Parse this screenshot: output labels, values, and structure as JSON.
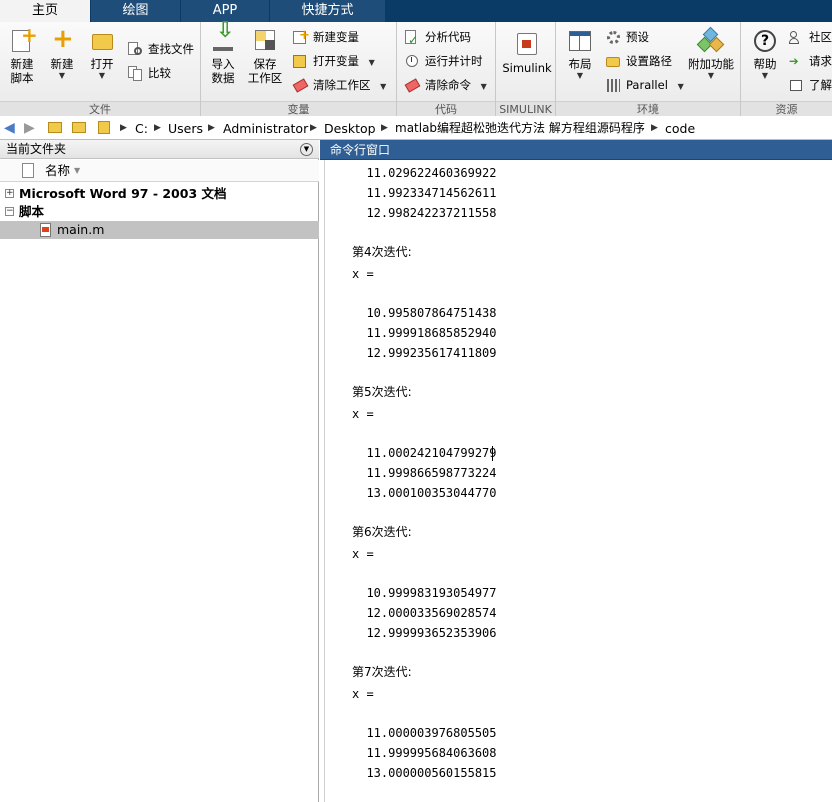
{
  "tabs": [
    {
      "label": "主页",
      "active": true
    },
    {
      "label": "绘图",
      "active": false
    },
    {
      "label": "APP",
      "active": false
    },
    {
      "label": "快捷方式",
      "active": false
    }
  ],
  "ribbon": {
    "file": {
      "group_label": "文件",
      "new_script": "新建\n脚本",
      "new": "新建",
      "open": "打开",
      "find_files": "查找文件",
      "compare": "比较"
    },
    "variable": {
      "group_label": "变量",
      "import_data": "导入\n数据",
      "save_workspace": "保存\n工作区",
      "new_variable": "新建变量",
      "open_variable": "打开变量",
      "clear_workspace": "清除工作区"
    },
    "code": {
      "group_label": "代码",
      "analyze_code": "分析代码",
      "run_and_time": "运行并计时",
      "clear_commands": "清除命令"
    },
    "simulink": {
      "group_label": "SIMULINK",
      "simulink": "Simulink"
    },
    "environment": {
      "group_label": "环境",
      "layout": "布局",
      "preferences": "预设",
      "set_path": "设置路径",
      "parallel": "Parallel",
      "add_ons": "附加功能"
    },
    "resources": {
      "group_label": "资源",
      "help": "帮助",
      "community": "社区",
      "request_support": "请求",
      "learn": "了解"
    }
  },
  "address": {
    "crumbs": [
      "C:",
      "Users",
      "Administrator",
      "Desktop",
      "matlab编程超松弛迭代方法 解方程组源码程序",
      "code"
    ]
  },
  "current_folder": {
    "title": "当前文件夹",
    "column_name": "名称",
    "groups": [
      {
        "label": "Microsoft Word 97 - 2003 文档",
        "expanded": false
      },
      {
        "label": "脚本",
        "expanded": true
      }
    ],
    "files": [
      {
        "name": "main.m",
        "selected": true
      }
    ]
  },
  "command_window": {
    "title": "命令行窗口",
    "lines": [
      {
        "text": "  11.029622460369922",
        "type": "value"
      },
      {
        "text": "  11.992334714562611",
        "type": "value"
      },
      {
        "text": "  12.998242237211558",
        "type": "value"
      },
      {
        "text": "第4次迭代:",
        "type": "head"
      },
      {
        "text": "x =",
        "type": "value"
      },
      {
        "text": "  10.995807864751438",
        "type": "value"
      },
      {
        "text": "  11.999918685852940",
        "type": "value"
      },
      {
        "text": "  12.999235617411809",
        "type": "value"
      },
      {
        "text": "第5次迭代:",
        "type": "head"
      },
      {
        "text": "x =",
        "type": "value"
      },
      {
        "text": "  11.000242104799279",
        "type": "value"
      },
      {
        "text": "  11.999866598773224",
        "type": "value"
      },
      {
        "text": "  13.000100353044770",
        "type": "value"
      },
      {
        "text": "第6次迭代:",
        "type": "head"
      },
      {
        "text": "x =",
        "type": "value"
      },
      {
        "text": "  10.999983193054977",
        "type": "value"
      },
      {
        "text": "  12.000033569028574",
        "type": "value"
      },
      {
        "text": "  12.999993652353906",
        "type": "value"
      },
      {
        "text": "第7次迭代:",
        "type": "head"
      },
      {
        "text": "x =",
        "type": "value"
      },
      {
        "text": "  11.000003976805505",
        "type": "value"
      },
      {
        "text": "  11.999995684063608",
        "type": "value"
      },
      {
        "text": "  13.000000560155815",
        "type": "value"
      }
    ]
  }
}
